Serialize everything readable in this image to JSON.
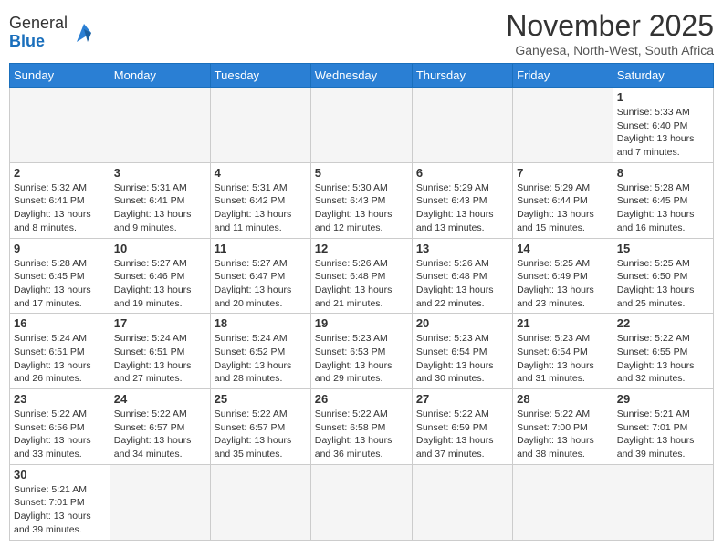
{
  "header": {
    "logo_general": "General",
    "logo_blue": "Blue",
    "month_title": "November 2025",
    "subtitle": "Ganyesa, North-West, South Africa"
  },
  "days_of_week": [
    "Sunday",
    "Monday",
    "Tuesday",
    "Wednesday",
    "Thursday",
    "Friday",
    "Saturday"
  ],
  "weeks": [
    [
      {
        "day": "",
        "info": ""
      },
      {
        "day": "",
        "info": ""
      },
      {
        "day": "",
        "info": ""
      },
      {
        "day": "",
        "info": ""
      },
      {
        "day": "",
        "info": ""
      },
      {
        "day": "",
        "info": ""
      },
      {
        "day": "1",
        "info": "Sunrise: 5:33 AM\nSunset: 6:40 PM\nDaylight: 13 hours and 7 minutes."
      }
    ],
    [
      {
        "day": "2",
        "info": "Sunrise: 5:32 AM\nSunset: 6:41 PM\nDaylight: 13 hours and 8 minutes."
      },
      {
        "day": "3",
        "info": "Sunrise: 5:31 AM\nSunset: 6:41 PM\nDaylight: 13 hours and 9 minutes."
      },
      {
        "day": "4",
        "info": "Sunrise: 5:31 AM\nSunset: 6:42 PM\nDaylight: 13 hours and 11 minutes."
      },
      {
        "day": "5",
        "info": "Sunrise: 5:30 AM\nSunset: 6:43 PM\nDaylight: 13 hours and 12 minutes."
      },
      {
        "day": "6",
        "info": "Sunrise: 5:29 AM\nSunset: 6:43 PM\nDaylight: 13 hours and 13 minutes."
      },
      {
        "day": "7",
        "info": "Sunrise: 5:29 AM\nSunset: 6:44 PM\nDaylight: 13 hours and 15 minutes."
      },
      {
        "day": "8",
        "info": "Sunrise: 5:28 AM\nSunset: 6:45 PM\nDaylight: 13 hours and 16 minutes."
      }
    ],
    [
      {
        "day": "9",
        "info": "Sunrise: 5:28 AM\nSunset: 6:45 PM\nDaylight: 13 hours and 17 minutes."
      },
      {
        "day": "10",
        "info": "Sunrise: 5:27 AM\nSunset: 6:46 PM\nDaylight: 13 hours and 19 minutes."
      },
      {
        "day": "11",
        "info": "Sunrise: 5:27 AM\nSunset: 6:47 PM\nDaylight: 13 hours and 20 minutes."
      },
      {
        "day": "12",
        "info": "Sunrise: 5:26 AM\nSunset: 6:48 PM\nDaylight: 13 hours and 21 minutes."
      },
      {
        "day": "13",
        "info": "Sunrise: 5:26 AM\nSunset: 6:48 PM\nDaylight: 13 hours and 22 minutes."
      },
      {
        "day": "14",
        "info": "Sunrise: 5:25 AM\nSunset: 6:49 PM\nDaylight: 13 hours and 23 minutes."
      },
      {
        "day": "15",
        "info": "Sunrise: 5:25 AM\nSunset: 6:50 PM\nDaylight: 13 hours and 25 minutes."
      }
    ],
    [
      {
        "day": "16",
        "info": "Sunrise: 5:24 AM\nSunset: 6:51 PM\nDaylight: 13 hours and 26 minutes."
      },
      {
        "day": "17",
        "info": "Sunrise: 5:24 AM\nSunset: 6:51 PM\nDaylight: 13 hours and 27 minutes."
      },
      {
        "day": "18",
        "info": "Sunrise: 5:24 AM\nSunset: 6:52 PM\nDaylight: 13 hours and 28 minutes."
      },
      {
        "day": "19",
        "info": "Sunrise: 5:23 AM\nSunset: 6:53 PM\nDaylight: 13 hours and 29 minutes."
      },
      {
        "day": "20",
        "info": "Sunrise: 5:23 AM\nSunset: 6:54 PM\nDaylight: 13 hours and 30 minutes."
      },
      {
        "day": "21",
        "info": "Sunrise: 5:23 AM\nSunset: 6:54 PM\nDaylight: 13 hours and 31 minutes."
      },
      {
        "day": "22",
        "info": "Sunrise: 5:22 AM\nSunset: 6:55 PM\nDaylight: 13 hours and 32 minutes."
      }
    ],
    [
      {
        "day": "23",
        "info": "Sunrise: 5:22 AM\nSunset: 6:56 PM\nDaylight: 13 hours and 33 minutes."
      },
      {
        "day": "24",
        "info": "Sunrise: 5:22 AM\nSunset: 6:57 PM\nDaylight: 13 hours and 34 minutes."
      },
      {
        "day": "25",
        "info": "Sunrise: 5:22 AM\nSunset: 6:57 PM\nDaylight: 13 hours and 35 minutes."
      },
      {
        "day": "26",
        "info": "Sunrise: 5:22 AM\nSunset: 6:58 PM\nDaylight: 13 hours and 36 minutes."
      },
      {
        "day": "27",
        "info": "Sunrise: 5:22 AM\nSunset: 6:59 PM\nDaylight: 13 hours and 37 minutes."
      },
      {
        "day": "28",
        "info": "Sunrise: 5:22 AM\nSunset: 7:00 PM\nDaylight: 13 hours and 38 minutes."
      },
      {
        "day": "29",
        "info": "Sunrise: 5:21 AM\nSunset: 7:01 PM\nDaylight: 13 hours and 39 minutes."
      }
    ],
    [
      {
        "day": "30",
        "info": "Sunrise: 5:21 AM\nSunset: 7:01 PM\nDaylight: 13 hours and 39 minutes."
      },
      {
        "day": "",
        "info": ""
      },
      {
        "day": "",
        "info": ""
      },
      {
        "day": "",
        "info": ""
      },
      {
        "day": "",
        "info": ""
      },
      {
        "day": "",
        "info": ""
      },
      {
        "day": "",
        "info": ""
      }
    ]
  ]
}
